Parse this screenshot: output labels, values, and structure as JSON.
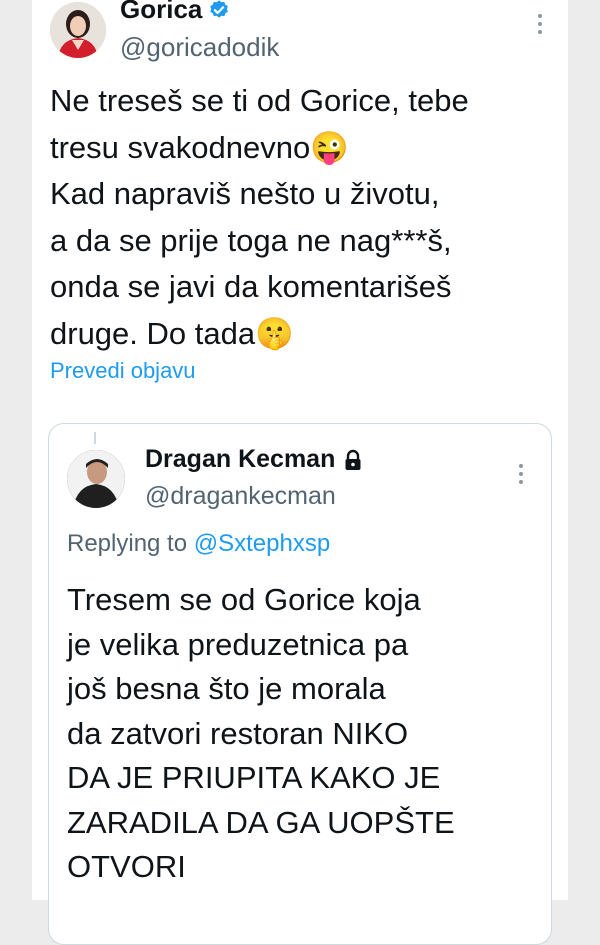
{
  "tweet": {
    "display_name": "Gorica",
    "handle": "@goricadodik",
    "text": "Ne treseš se ti od Gorice, tebe\ntresu svakodnevno😜\nKad napraviš nešto u životu,\na da se prije toga ne nag***š,\nonda se javi da komentarišeš\ndruge. Do tada🤫",
    "translate_label": "Prevedi objavu",
    "verified_icon": "verified-badge-icon",
    "accent_color": "#1d9bf0"
  },
  "quoted": {
    "display_name": "Dragan Kecman",
    "handle": "@dragankecman",
    "replying_prefix": "Replying to",
    "replying_to": "@Sxtephxsp",
    "text": "Tresem se od Gorice koja\nje velika preduzetnica pa\njoš besna što je morala\nda zatvori restoran NIKO\nDA JE PRIUPITA KAKO JE\nZARADILA DA GA UOPŠTE\nOTVORI",
    "lock_icon": "lock-icon"
  }
}
